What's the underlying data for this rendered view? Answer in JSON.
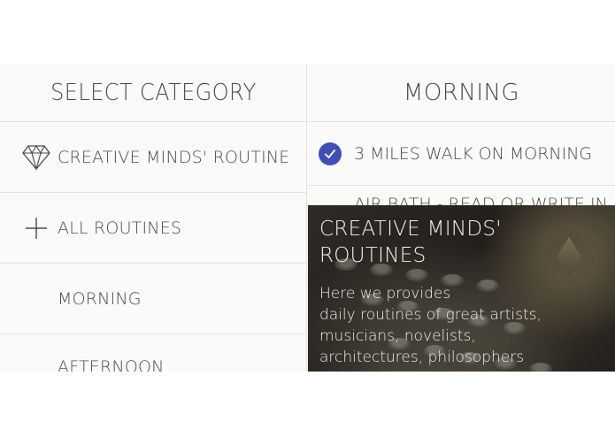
{
  "left_panel": {
    "header": "SELECT CATEGORY",
    "items": [
      {
        "label": "CREATIVE MINDS' ROUTINE",
        "icon": "diamond-icon"
      },
      {
        "label": "ALL ROUTINES",
        "icon": "plus-icon"
      },
      {
        "label": "MORNING"
      },
      {
        "label": "AFTERNOON"
      }
    ]
  },
  "right_panel": {
    "header": "MORNING",
    "items": [
      {
        "label": "3 MILES WALK ON MORNING",
        "checked": true
      },
      {
        "label": "AIR BATH - READ OR WRITE IN"
      }
    ]
  },
  "card": {
    "title_line1": "CREATIVE MINDS'",
    "title_line2": "ROUTINES",
    "body_line1": "Here we provides",
    "body_line2": "daily routines of great artists,",
    "body_line3": "musicians, novelists,",
    "body_line4": "architectures, philosophers"
  },
  "colors": {
    "accent": "#3f4fb5",
    "panel_bg": "#fafaf8",
    "divider": "#e2e2e2"
  }
}
